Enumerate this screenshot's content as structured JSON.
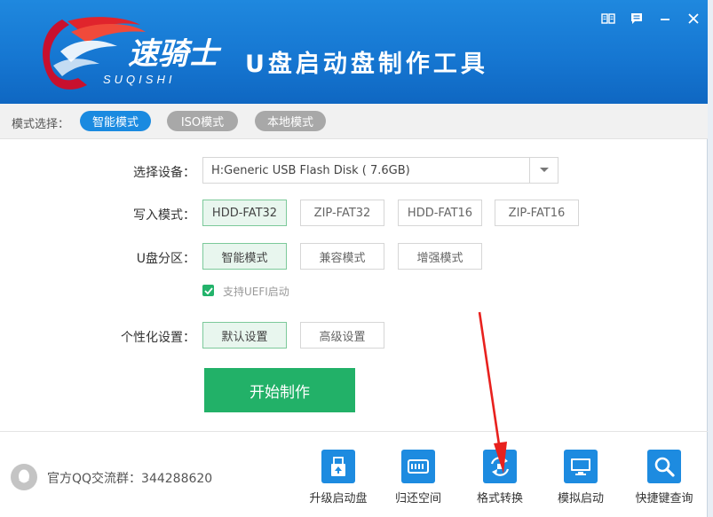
{
  "app": {
    "title": "U盘启动盘制作工具",
    "logo_text": "速骑士",
    "logo_sub": "SUQISHI"
  },
  "window_controls": [
    {
      "name": "guide-icon"
    },
    {
      "name": "feedback-icon"
    },
    {
      "name": "minimize-icon"
    },
    {
      "name": "close-icon"
    }
  ],
  "mode_bar": {
    "label": "模式选择：",
    "modes": [
      {
        "label": "智能模式",
        "active": true
      },
      {
        "label": "ISO模式",
        "active": false
      },
      {
        "label": "本地模式",
        "active": false
      }
    ]
  },
  "form": {
    "device": {
      "label": "选择设备：",
      "value": "H:Generic USB Flash Disk ( 7.6GB)"
    },
    "write_mode": {
      "label": "写入模式：",
      "options": [
        "HDD-FAT32",
        "ZIP-FAT32",
        "HDD-FAT16",
        "ZIP-FAT16"
      ],
      "selected": "HDD-FAT32"
    },
    "partition": {
      "label": "U盘分区：",
      "options": [
        "智能模式",
        "兼容模式",
        "增强模式"
      ],
      "selected": "智能模式"
    },
    "uefi": {
      "label": "支持UEFI启动",
      "checked": true
    },
    "personalize": {
      "label": "个性化设置：",
      "options": [
        "默认设置",
        "高级设置"
      ],
      "selected": "默认设置"
    },
    "start_label": "开始制作"
  },
  "footer": {
    "qq_text": "官方QQ交流群：344288620",
    "tools": [
      {
        "label": "升级启动盘",
        "icon": "upgrade-icon"
      },
      {
        "label": "归还空间",
        "icon": "disk-icon"
      },
      {
        "label": "格式转换",
        "icon": "convert-icon"
      },
      {
        "label": "模拟启动",
        "icon": "monitor-icon"
      },
      {
        "label": "快捷键查询",
        "icon": "search-icon"
      }
    ]
  },
  "colors": {
    "header_blue": "#1677d2",
    "accent_blue": "#1a8ae0",
    "start_green": "#22b168",
    "annotation_red": "#e8211e"
  }
}
